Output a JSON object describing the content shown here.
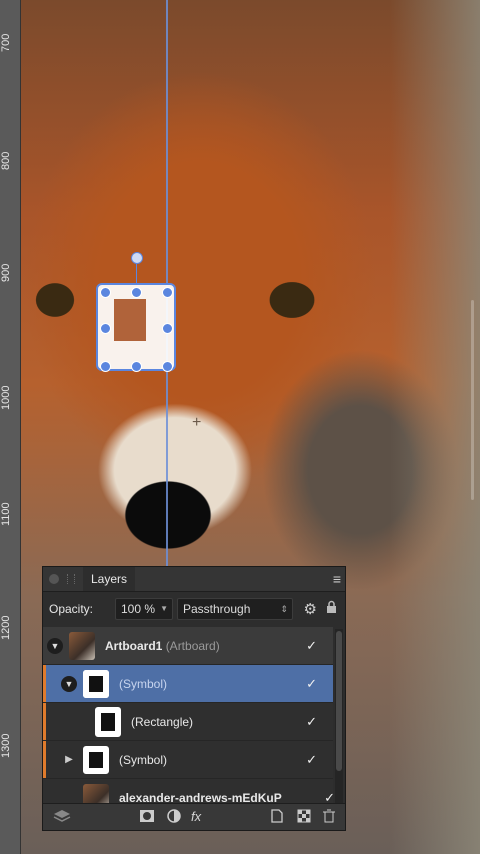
{
  "ruler": {
    "ticks": [
      "700",
      "800",
      "900",
      "1000",
      "1100",
      "1200",
      "1300"
    ]
  },
  "panel": {
    "tab_label": "Layers",
    "opacity_label": "Opacity:",
    "opacity_value": "100 %",
    "blend_mode": "Passthrough",
    "layers": [
      {
        "name": "Artboard1",
        "type": "(Artboard)",
        "checked": true
      },
      {
        "name": "",
        "type": "(Symbol)",
        "checked": true
      },
      {
        "name": "",
        "type": "(Rectangle)",
        "checked": true
      },
      {
        "name": "",
        "type": "(Symbol)",
        "checked": true
      },
      {
        "name": "alexander-andrews-mEdKuP",
        "type": "",
        "checked": true
      }
    ]
  },
  "icons": {
    "check": "✓",
    "menu": "≡",
    "gear": "⚙",
    "lock": "🔒",
    "fx": "fx"
  }
}
